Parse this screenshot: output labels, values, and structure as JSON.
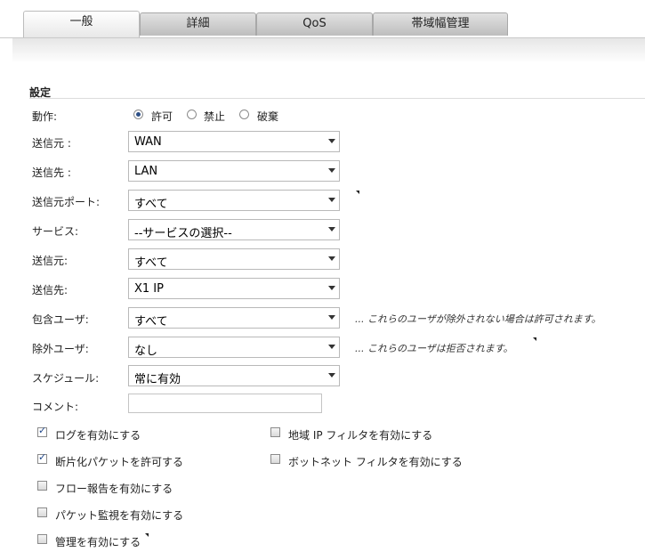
{
  "tabs": [
    {
      "label": "一般",
      "active": true
    },
    {
      "label": "詳細",
      "active": false
    },
    {
      "label": "QoS",
      "active": false
    },
    {
      "label": "帯域幅管理",
      "active": false
    }
  ],
  "section_title": "設定",
  "action": {
    "label": "動作:",
    "options": [
      "許可",
      "禁止",
      "破棄"
    ],
    "selected": "許可"
  },
  "fields": {
    "src_zone": {
      "label": "送信元 :",
      "value": "WAN"
    },
    "dst_zone": {
      "label": "送信先 :",
      "value": "LAN"
    },
    "src_port": {
      "label": "送信元ポート:",
      "value": "すべて"
    },
    "service": {
      "label": "サービス:",
      "value": "--サービスの選択--"
    },
    "source": {
      "label": "送信元:",
      "value": "すべて"
    },
    "destination": {
      "label": "送信先:",
      "value": "X1 IP"
    },
    "incl_users": {
      "label": "包含ユーザ:",
      "value": "すべて",
      "note": "... これらのユーザが除外されない場合は許可されます。"
    },
    "excl_users": {
      "label": "除外ユーザ:",
      "value": "なし",
      "note": "... これらのユーザは拒否されます。"
    },
    "schedule": {
      "label": "スケジュール:",
      "value": "常に有効"
    },
    "comment": {
      "label": "コメント:",
      "value": ""
    }
  },
  "checkboxes": {
    "enable_logging": {
      "label": "ログを有効にする",
      "checked": true
    },
    "allow_fragments": {
      "label": "断片化パケットを許可する",
      "checked": true
    },
    "enable_flow": {
      "label": "フロー報告を有効にする",
      "checked": false
    },
    "enable_monitoring": {
      "label": "パケット監視を有効にする",
      "checked": false
    },
    "enable_management": {
      "label": "管理を有効にする",
      "checked": false
    },
    "enable_geoip": {
      "label": "地域 IP フィルタを有効にする",
      "checked": false
    },
    "enable_botnet": {
      "label": "ボットネット フィルタを有効にする",
      "checked": false
    }
  }
}
